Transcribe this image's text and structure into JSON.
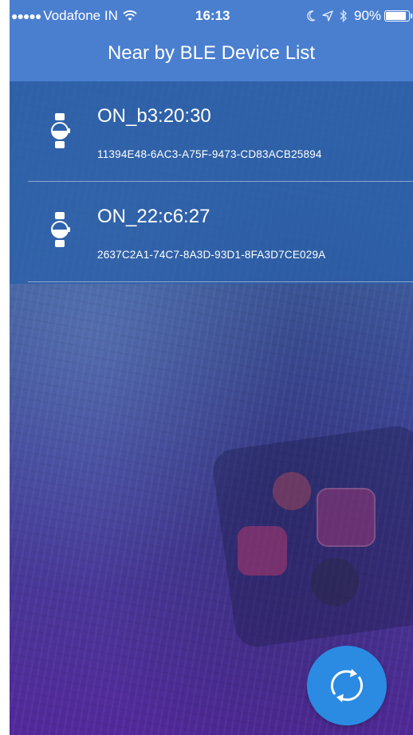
{
  "status_bar": {
    "signal_dots": "●●●●●",
    "carrier": "Vodafone IN",
    "time": "16:13",
    "battery_percent": "90%",
    "battery_level": 0.9,
    "icons": [
      "signal-dots-icon",
      "wifi-icon",
      "moon-icon",
      "location-arrow-icon",
      "bluetooth-icon",
      "battery-icon"
    ]
  },
  "nav": {
    "title": "Near by BLE Device List"
  },
  "devices": [
    {
      "name": "ON_b3:20:30",
      "uuid": "11394E48-6AC3-A75F-9473-CD83ACB25894",
      "icon": "watch-icon"
    },
    {
      "name": "ON_22:c6:27",
      "uuid": "2637C2A1-74C7-8A3D-93D1-8FA3D7CE029A",
      "icon": "watch-icon"
    }
  ],
  "refresh_button": {
    "icon": "refresh-icon"
  },
  "colors": {
    "header": "#4a7fd0",
    "list_background": "#2d5fa8",
    "fab": "#2b8be3",
    "text": "#ffffff"
  }
}
